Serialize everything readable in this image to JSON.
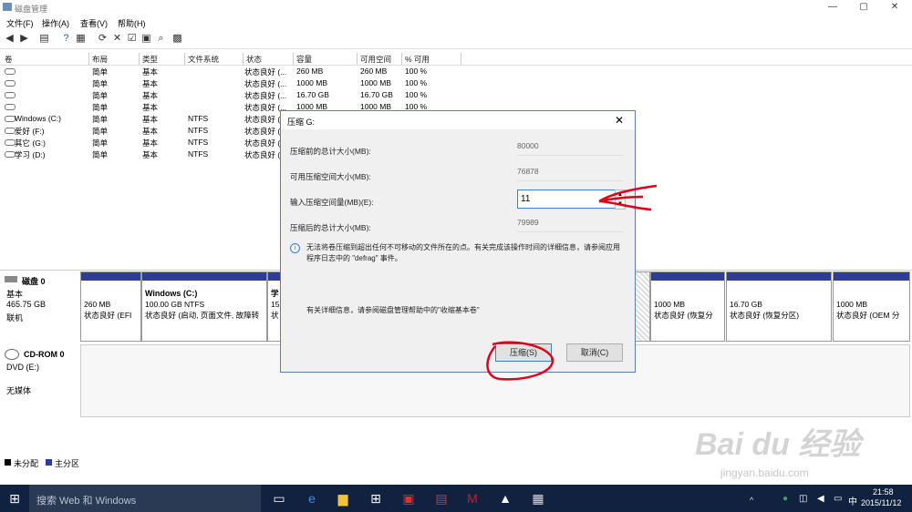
{
  "window": {
    "title": "磁盘管理",
    "min": "—",
    "max": "▢",
    "close": "✕"
  },
  "menu": [
    "文件(F)",
    "操作(A)",
    "查看(V)",
    "帮助(H)"
  ],
  "columns": [
    "卷",
    "布局",
    "类型",
    "文件系统",
    "状态",
    "容量",
    "可用空间",
    "% 可用"
  ],
  "volumes": [
    {
      "name": "",
      "layout": "简单",
      "type": "基本",
      "fs": "",
      "status": "状态良好 (...",
      "capacity": "260 MB",
      "free": "260 MB",
      "pct": "100 %"
    },
    {
      "name": "",
      "layout": "简单",
      "type": "基本",
      "fs": "",
      "status": "状态良好 (...",
      "capacity": "1000 MB",
      "free": "1000 MB",
      "pct": "100 %"
    },
    {
      "name": "",
      "layout": "简单",
      "type": "基本",
      "fs": "",
      "status": "状态良好 (...",
      "capacity": "16.70 GB",
      "free": "16.70 GB",
      "pct": "100 %"
    },
    {
      "name": "",
      "layout": "简单",
      "type": "基本",
      "fs": "",
      "status": "状态良好 (...",
      "capacity": "1000 MB",
      "free": "1000 MB",
      "pct": "100 %"
    },
    {
      "name": "Windows (C:)",
      "layout": "简单",
      "type": "基本",
      "fs": "NTFS",
      "status": "状态良好 (...",
      "capacity": "",
      "free": "",
      "pct": ""
    },
    {
      "name": "爱好 (F:)",
      "layout": "简单",
      "type": "基本",
      "fs": "NTFS",
      "status": "状态良好 (...",
      "capacity": "",
      "free": "",
      "pct": ""
    },
    {
      "name": "其它 (G:)",
      "layout": "简单",
      "type": "基本",
      "fs": "NTFS",
      "status": "状态良好 (...",
      "capacity": "",
      "free": "",
      "pct": ""
    },
    {
      "name": "学习 (D:)",
      "layout": "简单",
      "type": "基本",
      "fs": "NTFS",
      "status": "状态良好 (...",
      "capacity": "",
      "free": "",
      "pct": ""
    }
  ],
  "disk0": {
    "name": "磁盘 0",
    "type": "基本",
    "size": "465.75 GB",
    "status": "联机",
    "partitions": [
      {
        "title": "",
        "size": "260 MB",
        "status": "状态良好 (EFI"
      },
      {
        "title": "Windows  (C:)",
        "size": "100.00 GB NTFS",
        "status": "状态良好 (启动, 页面文件, 故障转"
      },
      {
        "title": "学",
        "size": "15",
        "status": "状"
      },
      {
        "title": "",
        "size": "1000 MB",
        "status": "状态良好 (恢复分"
      },
      {
        "title": "",
        "size": "16.70 GB",
        "status": "状态良好 (恢复分区)"
      },
      {
        "title": "",
        "size": "1000 MB",
        "status": "状态良好 (OEM 分"
      }
    ]
  },
  "cdrom0": {
    "name": "CD-ROM 0",
    "drive": "DVD (E:)",
    "media": "无媒体"
  },
  "legend": {
    "unallocated": "未分配",
    "primary": "主分区"
  },
  "dialog": {
    "title": "压缩 G:",
    "total_label": "压缩前的总计大小(MB):",
    "total_value": "80000",
    "avail_label": "可用压缩空间大小(MB):",
    "avail_value": "76878",
    "input_label": "输入压缩空间量(MB)(E):",
    "input_value": "11",
    "after_label": "压缩后的总计大小(MB):",
    "after_value": "79989",
    "info_text": "无法将卷压缩到超出任何不可移动的文件所在的点。有关完成该操作时间的详细信息，请参阅应用程序日志中的 \"defrag\" 事件。",
    "more_text": "有关详细信息，请参阅磁盘管理帮助中的\"收缩基本卷\"",
    "shrink_button": "压缩(S)",
    "cancel_button": "取消(C)"
  },
  "taskbar": {
    "search_placeholder": "搜索 Web 和 Windows",
    "time": "21:58",
    "date": "2015/11/12"
  },
  "watermark": {
    "brand": "Bai du 经验",
    "url": "jingyan.baidu.com"
  },
  "colors": {
    "primary_partition": "#2e3d9a",
    "taskbar": "#10223f",
    "annotation": "#e0001b"
  }
}
